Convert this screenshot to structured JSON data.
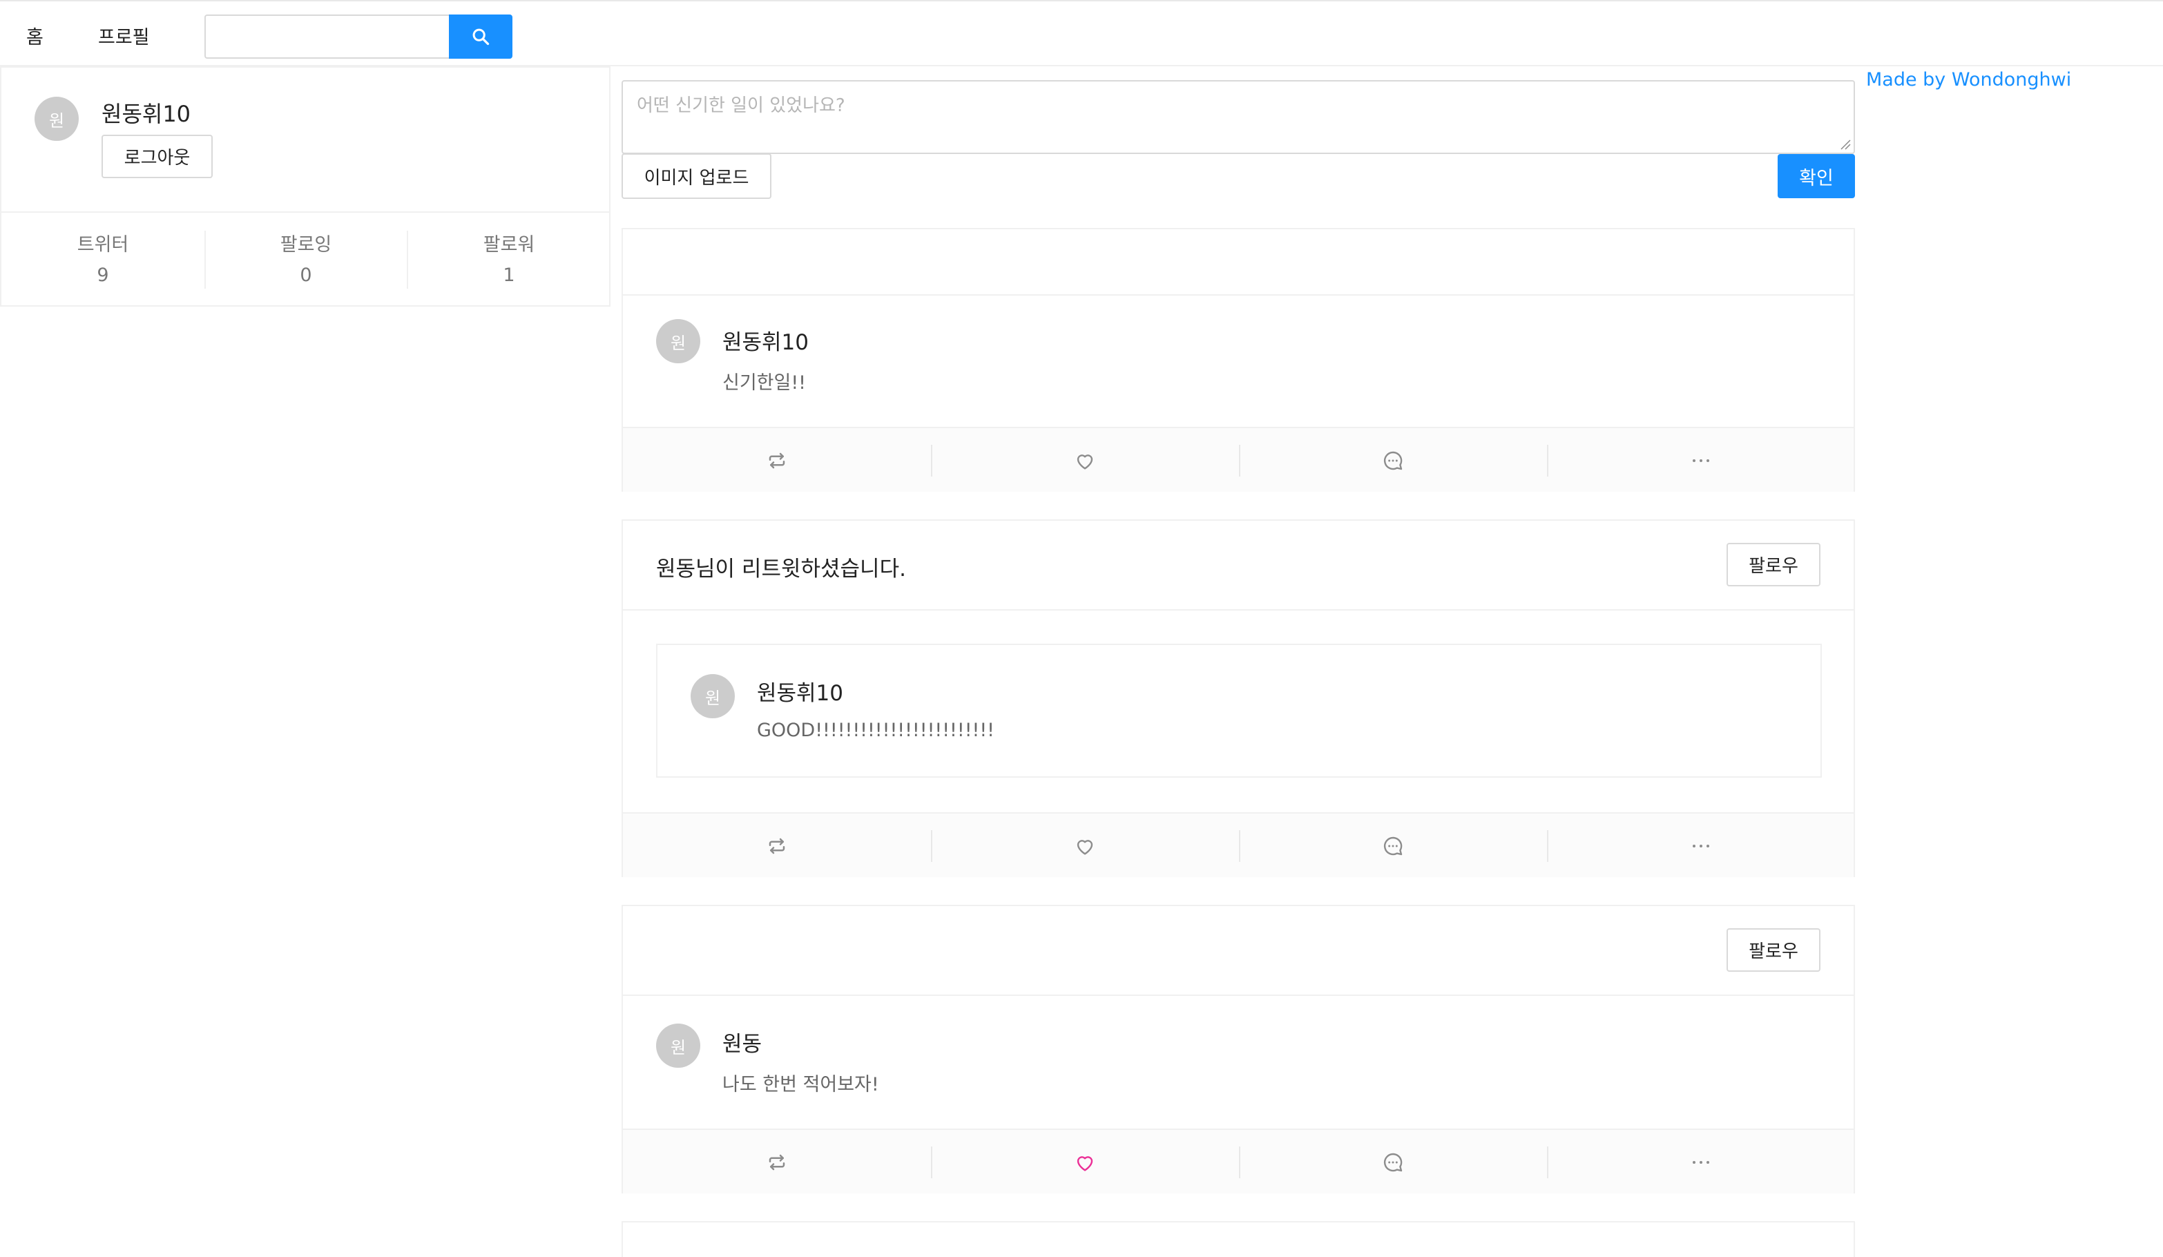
{
  "nav": {
    "home": "홈",
    "profile": "프로필",
    "search_placeholder": ""
  },
  "profile": {
    "avatar_initial": "원",
    "name": "원동휘10",
    "logout_label": "로그아웃",
    "stats": [
      {
        "label": "트위터",
        "value": "9"
      },
      {
        "label": "팔로잉",
        "value": "0"
      },
      {
        "label": "팔로워",
        "value": "1"
      }
    ]
  },
  "compose": {
    "placeholder": "어떤 신기한 일이 있었나요?",
    "upload_label": "이미지 업로드",
    "confirm_label": "확인"
  },
  "footer": {
    "made_by": "Made by Wondonghwi"
  },
  "feed": [
    {
      "header": "",
      "avatar_initial": "원",
      "author": "원동휘10",
      "content": "신기한일!!",
      "liked": false
    },
    {
      "header": "원동님이 리트윗하셨습니다.",
      "follow_label": "팔로우",
      "avatar_initial": "원",
      "author": "원동휘10",
      "content": "GOOD!!!!!!!!!!!!!!!!!!!!!!!!",
      "liked": false
    },
    {
      "header": "",
      "follow_label": "팔로우",
      "avatar_initial": "원",
      "author": "원동",
      "content": "나도 한번 적어보자!",
      "liked": true
    }
  ],
  "icons": [
    "search-icon",
    "retweet-icon",
    "heart-icon",
    "message-icon",
    "more-icon"
  ],
  "colors": {
    "accent": "#1890ff",
    "liked_heart": "#eb2f96",
    "icon": "#8c8c8c"
  }
}
